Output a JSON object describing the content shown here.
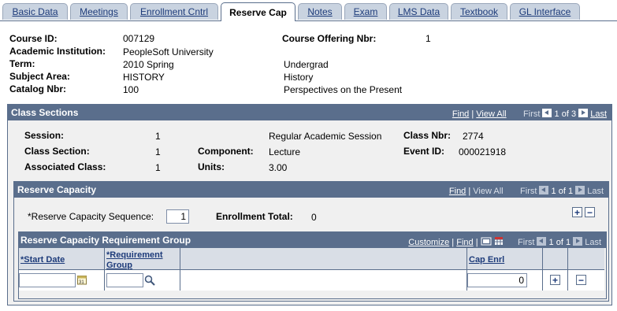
{
  "tabs": [
    {
      "label": "Basic Data",
      "active": false
    },
    {
      "label": "Meetings",
      "active": false
    },
    {
      "label": "Enrollment Cntrl",
      "active": false
    },
    {
      "label": "Reserve Cap",
      "active": true
    },
    {
      "label": "Notes",
      "active": false
    },
    {
      "label": "Exam",
      "active": false
    },
    {
      "label": "LMS Data",
      "active": false
    },
    {
      "label": "Textbook",
      "active": false
    },
    {
      "label": "GL Interface",
      "active": false
    }
  ],
  "course": {
    "course_id_label": "Course ID:",
    "course_id": "007129",
    "offering_label": "Course Offering Nbr:",
    "offering": "1",
    "institution_label": "Academic Institution:",
    "institution": "PeopleSoft University",
    "term_label": "Term:",
    "term": "2010 Spring",
    "career": "Undergrad",
    "subject_label": "Subject Area:",
    "subject": "HISTORY",
    "subject_desc": "History",
    "catalog_label": "Catalog Nbr:",
    "catalog": "100",
    "catalog_desc": "Perspectives on the Present"
  },
  "class_sections": {
    "title": "Class Sections",
    "nav": {
      "find": "Find",
      "view_all": "View All",
      "first": "First",
      "range": "1 of 3",
      "last": "Last"
    },
    "session_label": "Session:",
    "session": "1",
    "session_desc": "Regular Academic Session",
    "class_nbr_label": "Class Nbr:",
    "class_nbr": "2774",
    "section_label": "Class Section:",
    "section": "1",
    "component_label": "Component:",
    "component": "Lecture",
    "event_label": "Event ID:",
    "event": "000021918",
    "assoc_label": "Associated Class:",
    "assoc": "1",
    "units_label": "Units:",
    "units": "3.00"
  },
  "reserve_capacity": {
    "title": "Reserve Capacity",
    "nav": {
      "find": "Find",
      "view_all": "View All",
      "first": "First",
      "range": "1 of 1",
      "last": "Last"
    },
    "seq_label": "*Reserve Capacity Sequence:",
    "seq": "1",
    "enroll_total_label": "Enrollment Total:",
    "enroll_total": "0"
  },
  "req_group": {
    "title": "Reserve Capacity Requirement Group",
    "nav": {
      "customize": "Customize",
      "find": "Find",
      "first": "First",
      "range": "1 of 1",
      "last": "Last"
    },
    "col_start": "*Start Date",
    "col_req_line1": "*Requirement",
    "col_req_line2": "Group",
    "col_cap": "Cap Enrl",
    "row": {
      "start_date": "",
      "req_group": "",
      "cap_enrl": "0"
    }
  },
  "icons": {
    "calendar": "calendar-icon",
    "lookup": "magnifier-icon",
    "add": "+",
    "delete": "−"
  }
}
